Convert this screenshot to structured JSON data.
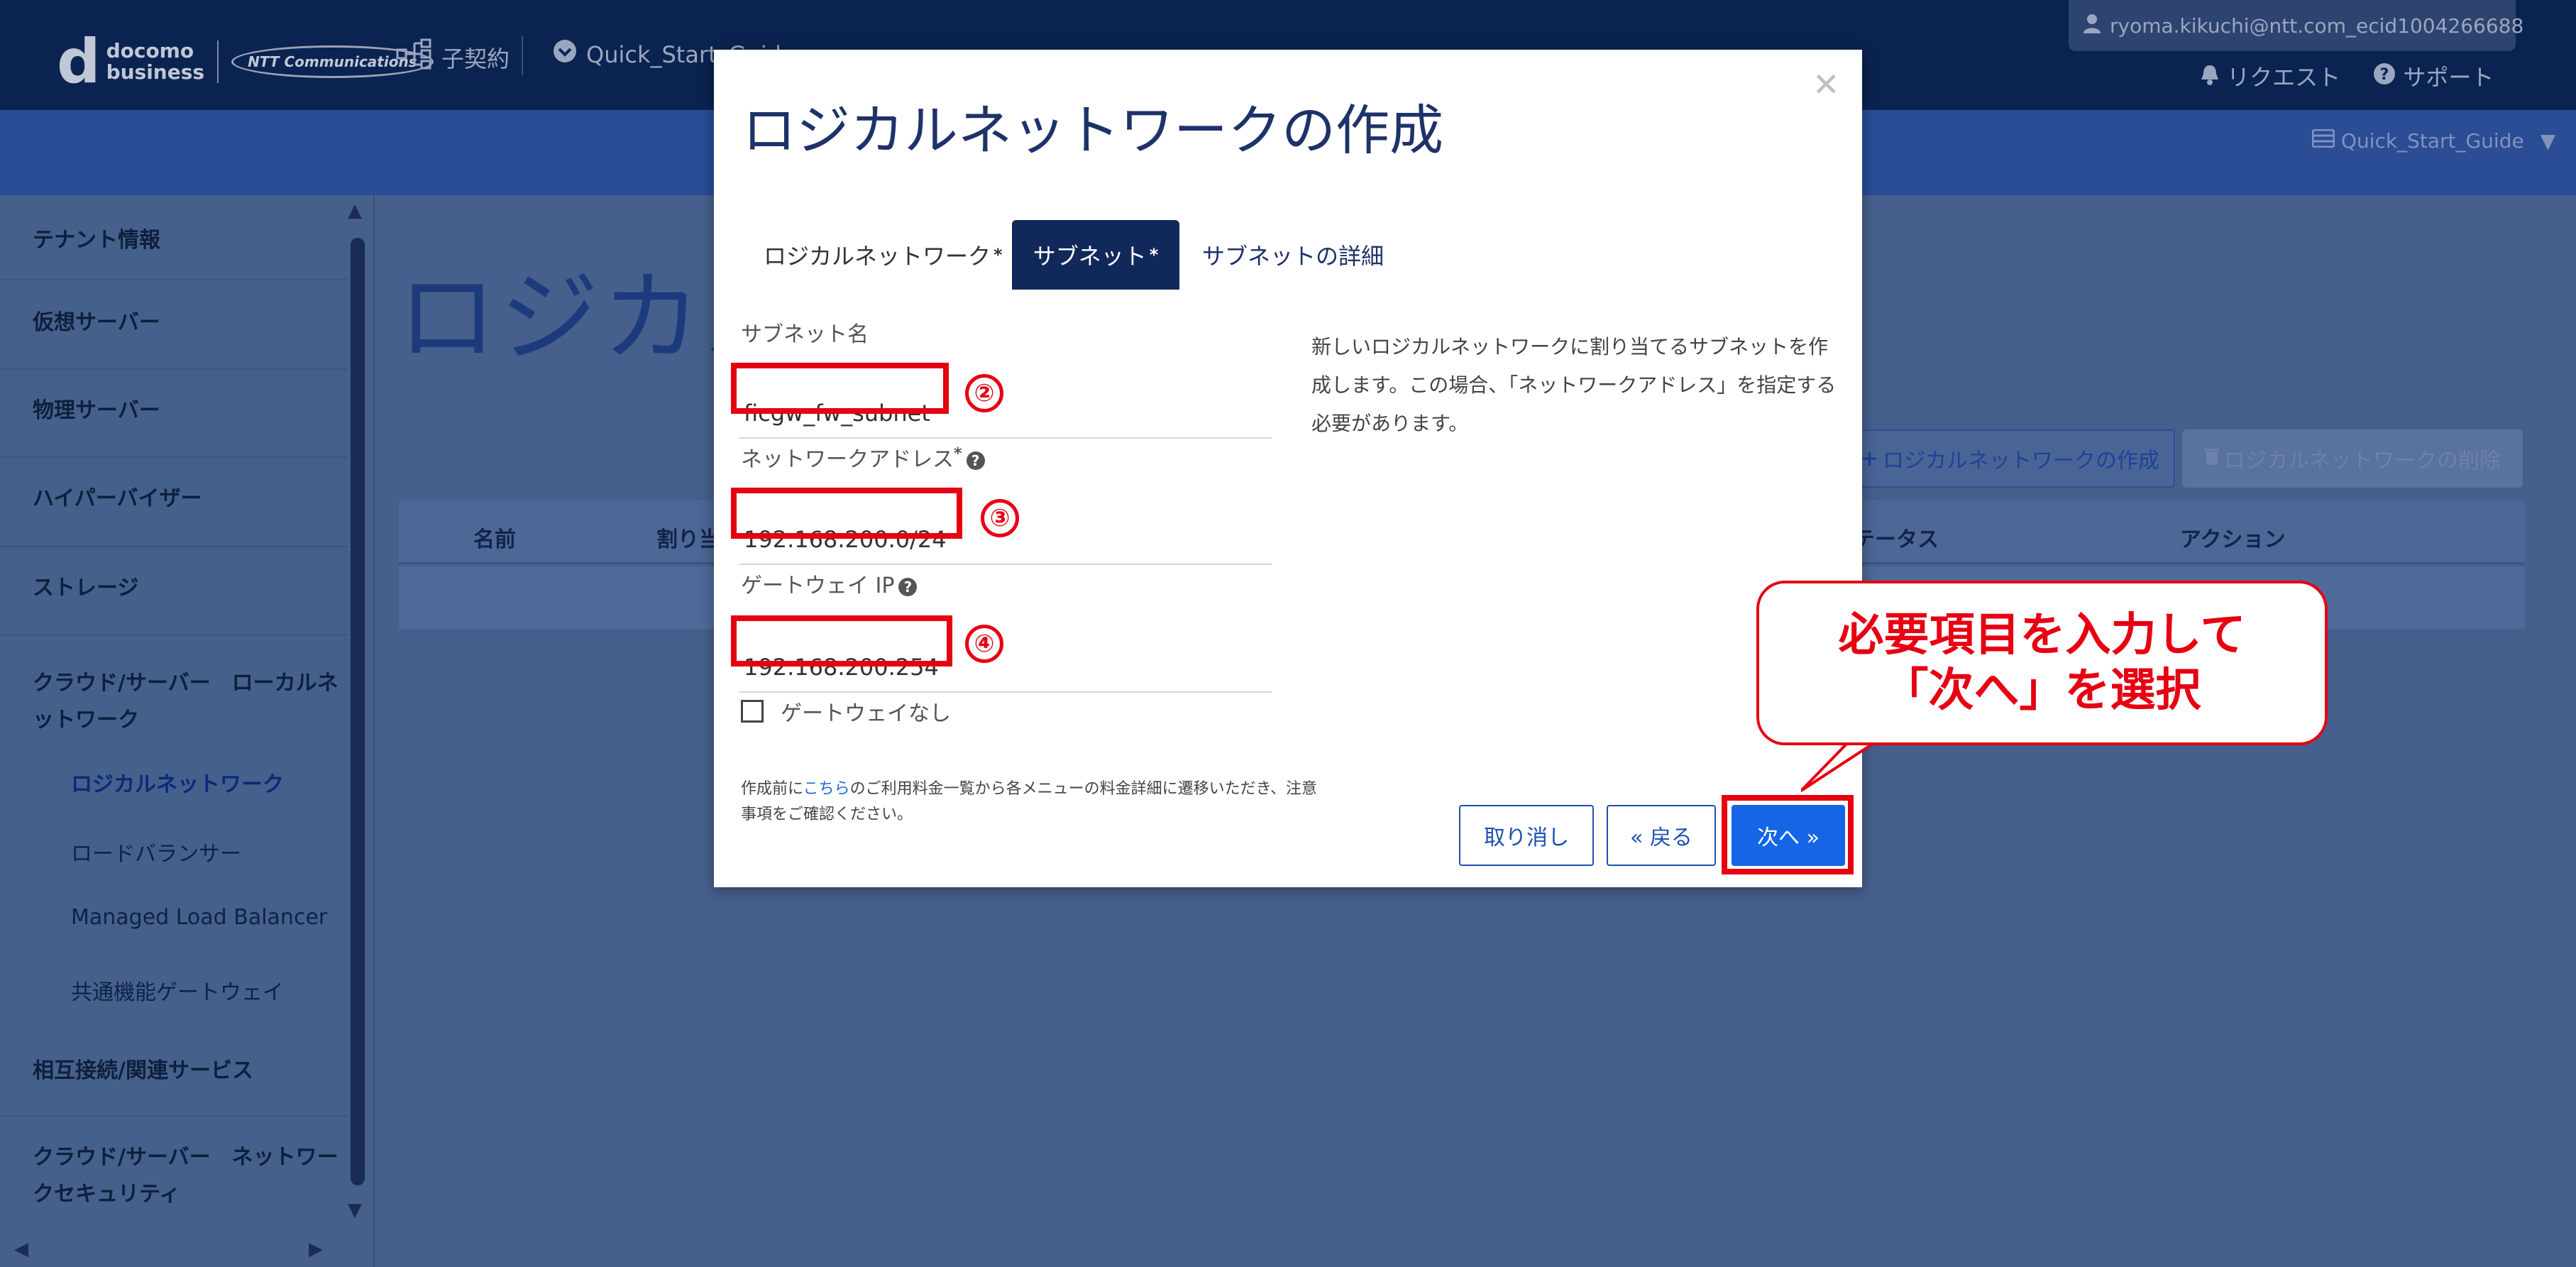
{
  "header": {
    "logo_d": "d",
    "logo_line1": "docomo",
    "logo_line2": "business",
    "logo_ntt": "NTT Communications",
    "nav_contract": "子契約",
    "nav_tenant": "Quick_Start_Guide",
    "user": "ryoma.kikuchi@ntt.com_ecid1004266688",
    "request": "リクエスト",
    "support": "サポート",
    "tenant_select": "Quick_Start_Guide"
  },
  "sidebar": {
    "items": [
      "テナント情報",
      "仮想サーバー",
      "物理サーバー",
      "ハイパーバイザー",
      "ストレージ",
      "クラウド/サーバー　ローカルネットワーク",
      "相互接続/関連サービス",
      "クラウド/サーバー　ネットワークセキュリティ"
    ],
    "subitems": [
      "ロジカルネットワーク",
      "ロードバランサー",
      "Managed Load Balancer",
      "共通機能ゲートウェイ"
    ]
  },
  "main": {
    "page_title": "ロジカル",
    "create_button": "ロジカルネットワークの作成",
    "delete_button": "ロジカルネットワークの削除",
    "columns": {
      "name": "名前",
      "assign": "割り当",
      "status": "テータス",
      "action": "アクション"
    }
  },
  "modal": {
    "title": "ロジカルネットワークの作成",
    "tabs": [
      "ロジカルネットワーク",
      "サブネット",
      "サブネットの詳細"
    ],
    "required_mark": "*",
    "subnet_name_label": "サブネット名",
    "subnet_name_value": "ficgw_fw_subnet",
    "network_address_label": "ネットワークアドレス",
    "network_address_value": "192.168.200.0/24",
    "gateway_label": "ゲートウェイ IP",
    "gateway_value": "192.168.200.254",
    "no_gateway_label": "ゲートウェイなし",
    "description": "新しいロジカルネットワークに割り当てるサブネットを作成します。この場合、「ネットワークアドレス」を指定する必要があります。",
    "note_prefix": "作成前に",
    "note_link": "こちら",
    "note_suffix": "のご利用料金一覧から各メニューの料金詳細に遷移いただき、注意事項をご確認ください。",
    "cancel_button": "取り消し",
    "back_button": "« 戻る",
    "next_button": "次へ »"
  },
  "annotations": {
    "num2": "②",
    "num3": "③",
    "num4": "④",
    "callout": "必要項目を入力して\n「次へ」を選択"
  },
  "colors": {
    "header": "#0b2350",
    "accent": "#1565e6",
    "annotation_red": "#e60012",
    "active_tab": "#11285a"
  }
}
